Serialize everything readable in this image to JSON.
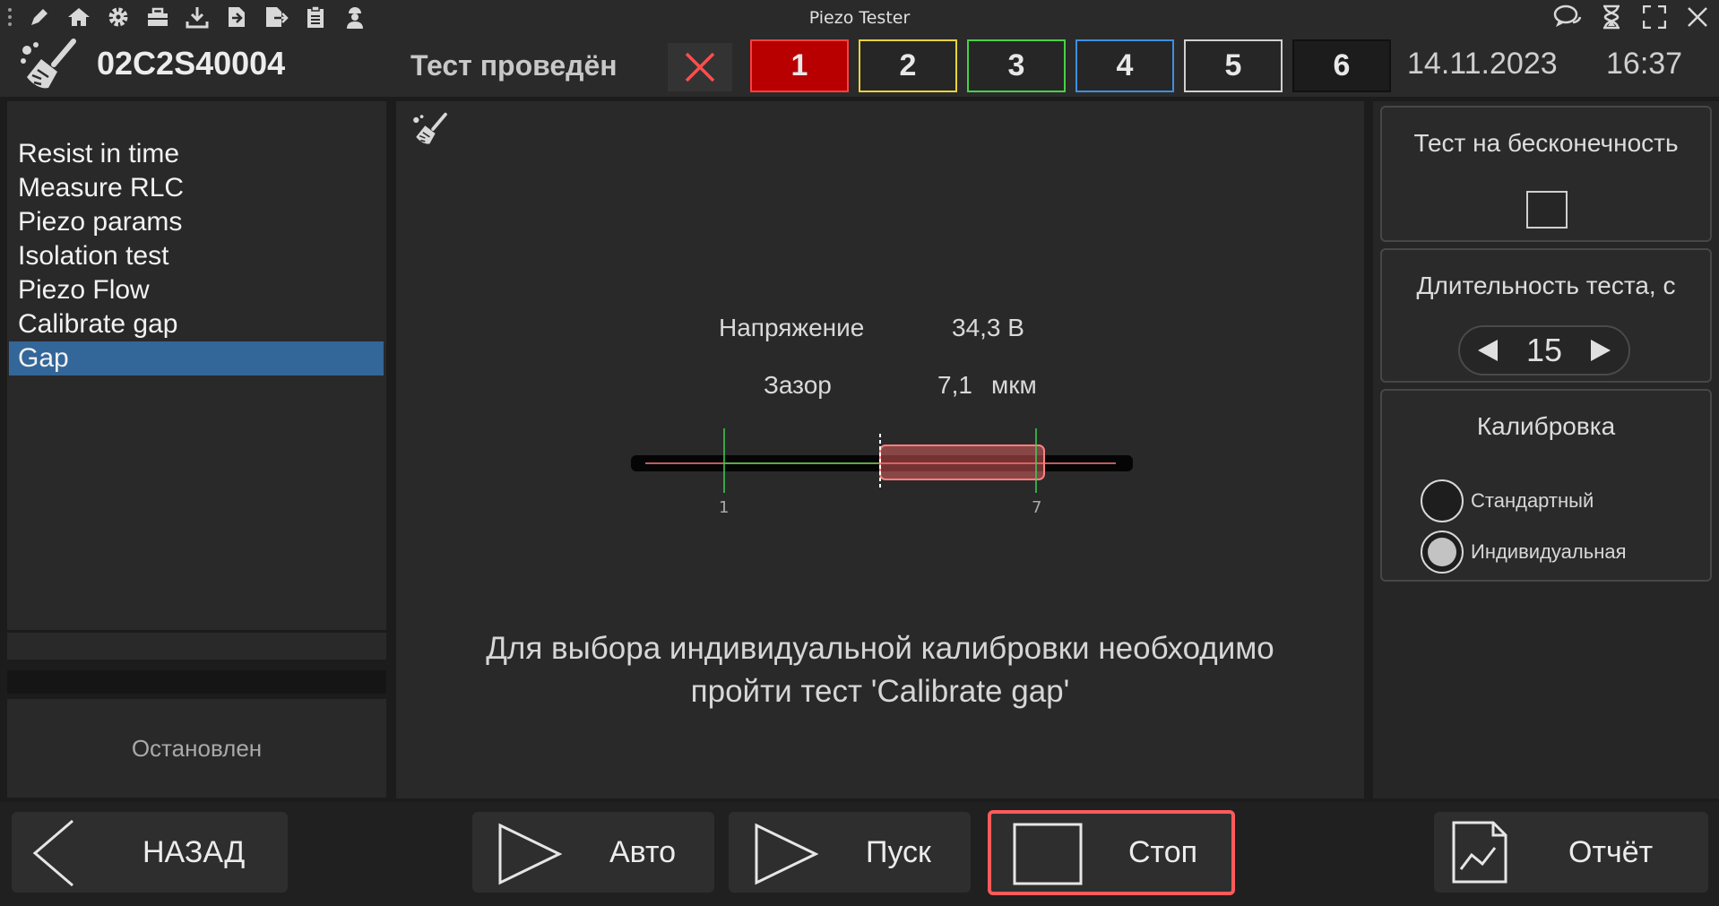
{
  "window": {
    "title": "Piezo Tester",
    "toolbar_icons": [
      "pencil-icon",
      "home-icon",
      "gear-icon",
      "toolbox-icon",
      "download-icon",
      "import-icon",
      "export-icon",
      "clipboard-icon",
      "worker-icon"
    ],
    "controls": [
      "chat-icon",
      "hourglass-icon",
      "fullscreen-icon",
      "close-icon"
    ]
  },
  "header": {
    "serial": "02C2S40004",
    "status": "Тест проведён",
    "channels": [
      {
        "label": "1",
        "color": "#ff4040",
        "fill": "#b80000"
      },
      {
        "label": "2",
        "color": "#e8d23a",
        "fill": "#262626"
      },
      {
        "label": "3",
        "color": "#49d046",
        "fill": "#262626"
      },
      {
        "label": "4",
        "color": "#3f8fe0",
        "fill": "#262626"
      },
      {
        "label": "5",
        "color": "#d0d0d0",
        "fill": "#262626"
      },
      {
        "label": "6",
        "color": "#111111",
        "fill": "#1c1c1c"
      }
    ],
    "date": "14.11.2023",
    "time": "16:37"
  },
  "tests": {
    "items": [
      "Resist in time",
      "Measure RLC",
      "Piezo params",
      "Isolation test",
      "Piezo Flow",
      "Calibrate gap",
      "Gap"
    ],
    "selected_index": 6,
    "state": "Остановлен"
  },
  "center": {
    "voltage_label": "Напряжение",
    "voltage_value": "34,3 В",
    "gap_label": "Зазор",
    "gap_value": "7,1",
    "gap_unit": "мкм",
    "gauge": {
      "tick_min_label": "1",
      "tick_max_label": "7"
    },
    "note_line1": "Для выбора индивидуальной калибровки необходимо",
    "note_line2": "пройти тест 'Calibrate gap'"
  },
  "right": {
    "infinite_title": "Тест на бесконечность",
    "infinite_checked": false,
    "duration_title": "Длительность теста, с",
    "duration_value": "15",
    "calib_title": "Калибровка",
    "calib_options": [
      "Стандартный",
      "Индивидуальная"
    ],
    "calib_selected": 1
  },
  "bottom": {
    "back": "НАЗАД",
    "auto": "Авто",
    "start": "Пуск",
    "stop": "Стоп",
    "report": "Отчёт"
  },
  "colors": {
    "accent_selected": "#336699",
    "stop_border": "#ff5a5a",
    "status_x": "#ff4d4d",
    "gauge_fill": "#ff6b6b",
    "gauge_tick": "#3fcf55"
  }
}
